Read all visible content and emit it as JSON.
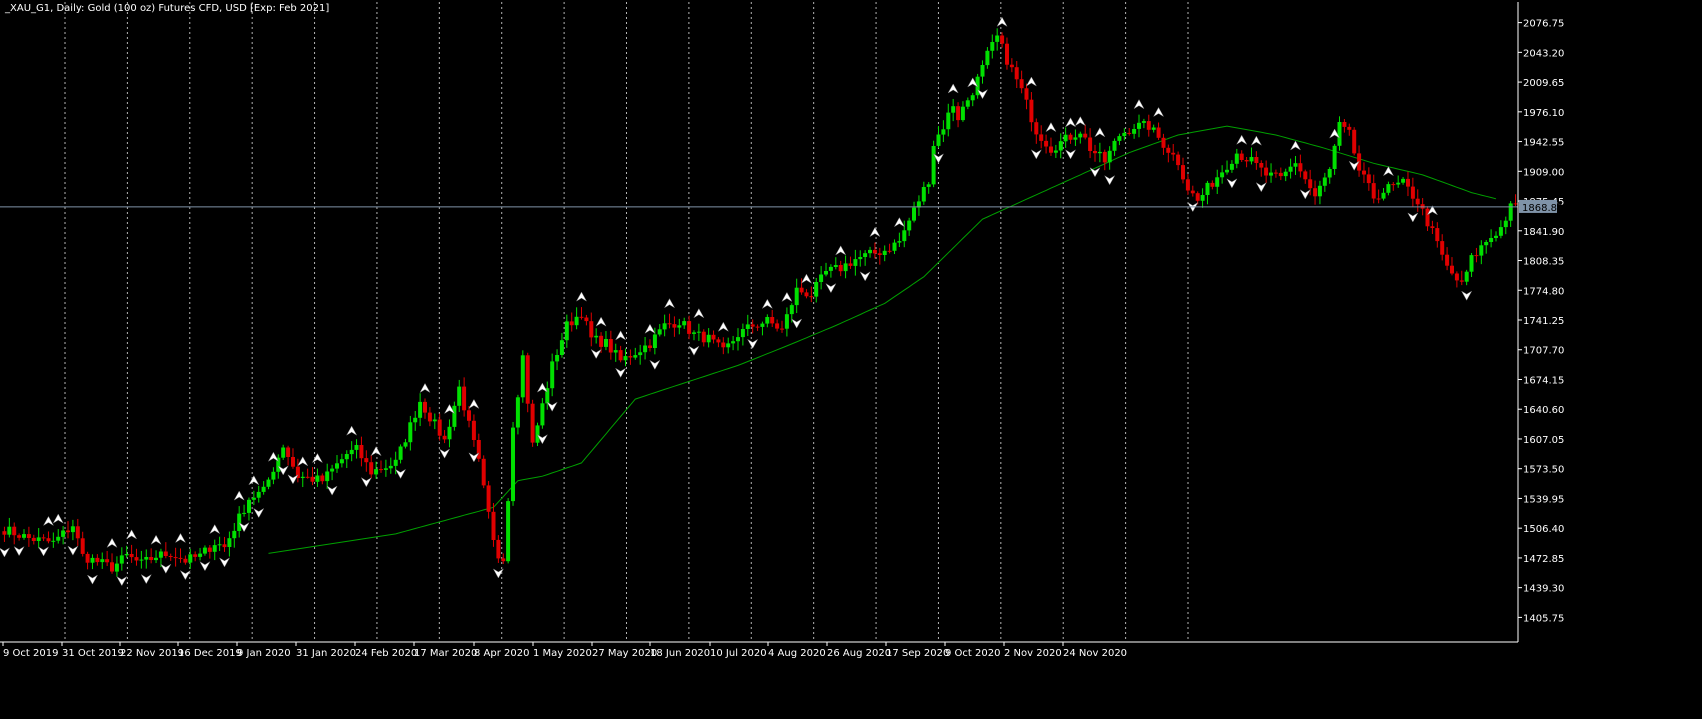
{
  "window": {
    "title": "_XAU_G1, Daily:  Gold (100 oz) Futures CFD, USD [Exp: Feb 2021]"
  },
  "colors": {
    "background": "#000000",
    "bull": "#00e000",
    "bear": "#e00000",
    "moving_average": "#00a000",
    "grid": "#ffffff",
    "axis": "#ffffff",
    "current_price_line": "#7f93a8",
    "fractal": "#ffffff"
  },
  "chart_data": {
    "type": "candlestick",
    "symbol": "_XAU_G1",
    "timeframe": "Daily",
    "current_price": "1868.82",
    "price_scale": [
      "2076.75",
      "2043.20",
      "2009.65",
      "1976.10",
      "1942.55",
      "1909.00",
      "1875.45",
      "1841.90",
      "1808.35",
      "1774.80",
      "1741.25",
      "1707.70",
      "1674.15",
      "1640.60",
      "1607.05",
      "1573.50",
      "1539.95",
      "1506.40",
      "1472.85",
      "1439.30",
      "1405.75"
    ],
    "time_labels": [
      "9 Oct 2019",
      "31 Oct 2019",
      "22 Nov 2019",
      "16 Dec 2019",
      "9 Jan 2020",
      "31 Jan 2020",
      "24 Feb 2020",
      "17 Mar 2020",
      "8 Apr 2020",
      "1 May 2020",
      "27 May 2020",
      "18 Jun 2020",
      "10 Jul 2020",
      "4 Aug 2020",
      "26 Aug 2020",
      "17 Sep 2020",
      "9 Oct 2020",
      "2 Nov 2020",
      "24 Nov 2020"
    ],
    "ylim": [
      1378,
      2100
    ],
    "grid": "vertical dotted",
    "indicators": [
      "Moving Average",
      "Fractals"
    ],
    "close_path": [
      [
        0,
        1505
      ],
      [
        5,
        1495
      ],
      [
        10,
        1490
      ],
      [
        14,
        1510
      ],
      [
        16,
        1475
      ],
      [
        22,
        1462
      ],
      [
        25,
        1475
      ],
      [
        28,
        1466
      ],
      [
        31,
        1475
      ],
      [
        34,
        1478
      ],
      [
        37,
        1470
      ],
      [
        40,
        1475
      ],
      [
        43,
        1490
      ],
      [
        45,
        1485
      ],
      [
        50,
        1540
      ],
      [
        53,
        1548
      ],
      [
        57,
        1600
      ],
      [
        60,
        1565
      ],
      [
        65,
        1560
      ],
      [
        70,
        1590
      ],
      [
        72,
        1595
      ],
      [
        75,
        1570
      ],
      [
        80,
        1580
      ],
      [
        85,
        1650
      ],
      [
        90,
        1605
      ],
      [
        93,
        1665
      ],
      [
        97,
        1580
      ],
      [
        100,
        1490
      ],
      [
        101,
        1475
      ],
      [
        102,
        1475
      ],
      [
        103,
        1540
      ],
      [
        104,
        1625
      ],
      [
        105,
        1660
      ],
      [
        106,
        1700
      ],
      [
        107,
        1650
      ],
      [
        108,
        1600
      ],
      [
        112,
        1690
      ],
      [
        115,
        1735
      ],
      [
        118,
        1750
      ],
      [
        120,
        1720
      ],
      [
        123,
        1715
      ],
      [
        126,
        1695
      ],
      [
        129,
        1705
      ],
      [
        132,
        1715
      ],
      [
        135,
        1735
      ],
      [
        138,
        1740
      ],
      [
        141,
        1725
      ],
      [
        144,
        1720
      ],
      [
        147,
        1705
      ],
      [
        150,
        1725
      ],
      [
        153,
        1735
      ],
      [
        156,
        1740
      ],
      [
        159,
        1730
      ],
      [
        162,
        1775
      ],
      [
        165,
        1770
      ],
      [
        168,
        1795
      ],
      [
        171,
        1800
      ],
      [
        174,
        1810
      ],
      [
        177,
        1815
      ],
      [
        180,
        1820
      ],
      [
        183,
        1830
      ],
      [
        186,
        1865
      ],
      [
        189,
        1900
      ],
      [
        190,
        1940
      ],
      [
        192,
        1960
      ],
      [
        194,
        1985
      ],
      [
        195,
        1970
      ],
      [
        198,
        2000
      ],
      [
        200,
        2025
      ],
      [
        201,
        2040
      ],
      [
        203,
        2060
      ],
      [
        205,
        2035
      ],
      [
        208,
        2000
      ],
      [
        211,
        1955
      ],
      [
        214,
        1935
      ],
      [
        217,
        1945
      ],
      [
        220,
        1955
      ],
      [
        222,
        1935
      ],
      [
        225,
        1920
      ],
      [
        228,
        1950
      ],
      [
        231,
        1960
      ],
      [
        234,
        1960
      ],
      [
        237,
        1940
      ],
      [
        240,
        1920
      ],
      [
        242,
        1890
      ],
      [
        244,
        1875
      ],
      [
        246,
        1890
      ],
      [
        249,
        1910
      ],
      [
        252,
        1930
      ],
      [
        255,
        1920
      ],
      [
        258,
        1905
      ],
      [
        261,
        1900
      ],
      [
        264,
        1920
      ],
      [
        266,
        1900
      ],
      [
        268,
        1880
      ],
      [
        271,
        1910
      ],
      [
        273,
        1960
      ],
      [
        275,
        1950
      ],
      [
        277,
        1910
      ],
      [
        280,
        1880
      ],
      [
        283,
        1890
      ],
      [
        286,
        1895
      ],
      [
        289,
        1875
      ],
      [
        292,
        1840
      ],
      [
        295,
        1800
      ],
      [
        298,
        1780
      ],
      [
        300,
        1810
      ],
      [
        303,
        1830
      ],
      [
        306,
        1845
      ],
      [
        308,
        1868
      ]
    ],
    "moving_average_path": [
      [
        54,
        1478
      ],
      [
        80,
        1500
      ],
      [
        100,
        1530
      ],
      [
        105,
        1560
      ],
      [
        110,
        1565
      ],
      [
        118,
        1580
      ],
      [
        129,
        1652
      ],
      [
        135,
        1663
      ],
      [
        150,
        1690
      ],
      [
        160,
        1712
      ],
      [
        170,
        1735
      ],
      [
        180,
        1760
      ],
      [
        188,
        1790
      ],
      [
        200,
        1855
      ],
      [
        210,
        1880
      ],
      [
        220,
        1905
      ],
      [
        230,
        1930
      ],
      [
        240,
        1950
      ],
      [
        250,
        1960
      ],
      [
        260,
        1950
      ],
      [
        270,
        1935
      ],
      [
        280,
        1918
      ],
      [
        290,
        1905
      ],
      [
        300,
        1885
      ],
      [
        305,
        1878
      ]
    ],
    "fractals_up_bars": [
      9,
      11,
      22,
      26,
      31,
      36,
      43,
      48,
      51,
      55,
      61,
      64,
      71,
      76,
      86,
      91,
      96,
      110,
      118,
      122,
      126,
      132,
      136,
      142,
      147,
      156,
      160,
      164,
      171,
      178,
      183,
      194,
      198,
      204,
      210,
      214,
      218,
      220,
      224,
      232,
      236,
      253,
      256,
      264,
      272,
      283,
      292
    ],
    "fractals_down_bars": [
      0,
      3,
      8,
      14,
      18,
      24,
      29,
      33,
      37,
      41,
      45,
      49,
      52,
      57,
      59,
      67,
      74,
      81,
      90,
      96,
      101,
      110,
      112,
      121,
      126,
      133,
      141,
      153,
      162,
      169,
      176,
      191,
      200,
      211,
      218,
      223,
      226,
      243,
      251,
      257,
      266,
      276,
      288,
      299
    ]
  }
}
